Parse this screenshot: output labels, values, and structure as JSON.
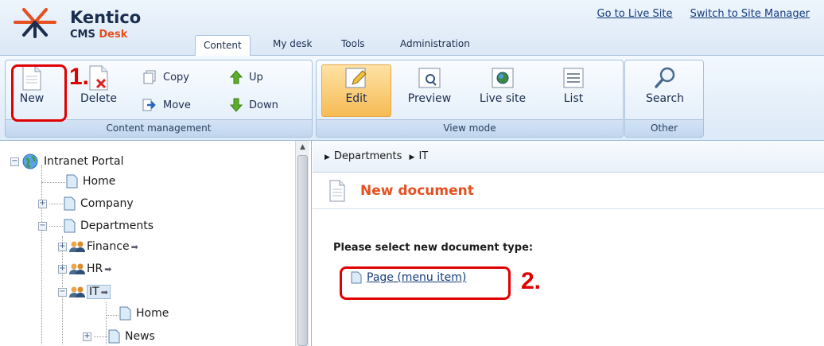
{
  "header": {
    "brand": "Kentico",
    "product_prefix": "CMS",
    "product_suffix": "Desk",
    "links": [
      "Go to Live Site",
      "Switch to Site Manager"
    ],
    "tabs": [
      "Content",
      "My desk",
      "Tools",
      "Administration"
    ],
    "active_tab": "Content"
  },
  "ribbon": {
    "content_management": {
      "title": "Content management",
      "new_label": "New",
      "delete_label": "Delete",
      "copy_label": "Copy",
      "move_label": "Move",
      "up_label": "Up",
      "down_label": "Down"
    },
    "view_mode": {
      "title": "View mode",
      "edit_label": "Edit",
      "preview_label": "Preview",
      "live_site_label": "Live site",
      "list_label": "List",
      "active": "Edit"
    },
    "other": {
      "title": "Other",
      "search_label": "Search"
    }
  },
  "annotations": {
    "step1": "1.",
    "step2": "2."
  },
  "tree": {
    "root": "Intranet Portal",
    "nodes": [
      "Home",
      "Company",
      "Departments",
      "Finance",
      "HR",
      "IT",
      "Home",
      "News"
    ],
    "selected": "IT"
  },
  "content": {
    "breadcrumb": [
      "Departments",
      "IT"
    ],
    "page_title": "New document",
    "instruction": "Please select new document type:",
    "document_types": [
      "Page (menu item)"
    ]
  },
  "colors": {
    "accent_orange": "#e4501f",
    "highlight_red": "#e00000",
    "link_blue": "#153d7e"
  }
}
